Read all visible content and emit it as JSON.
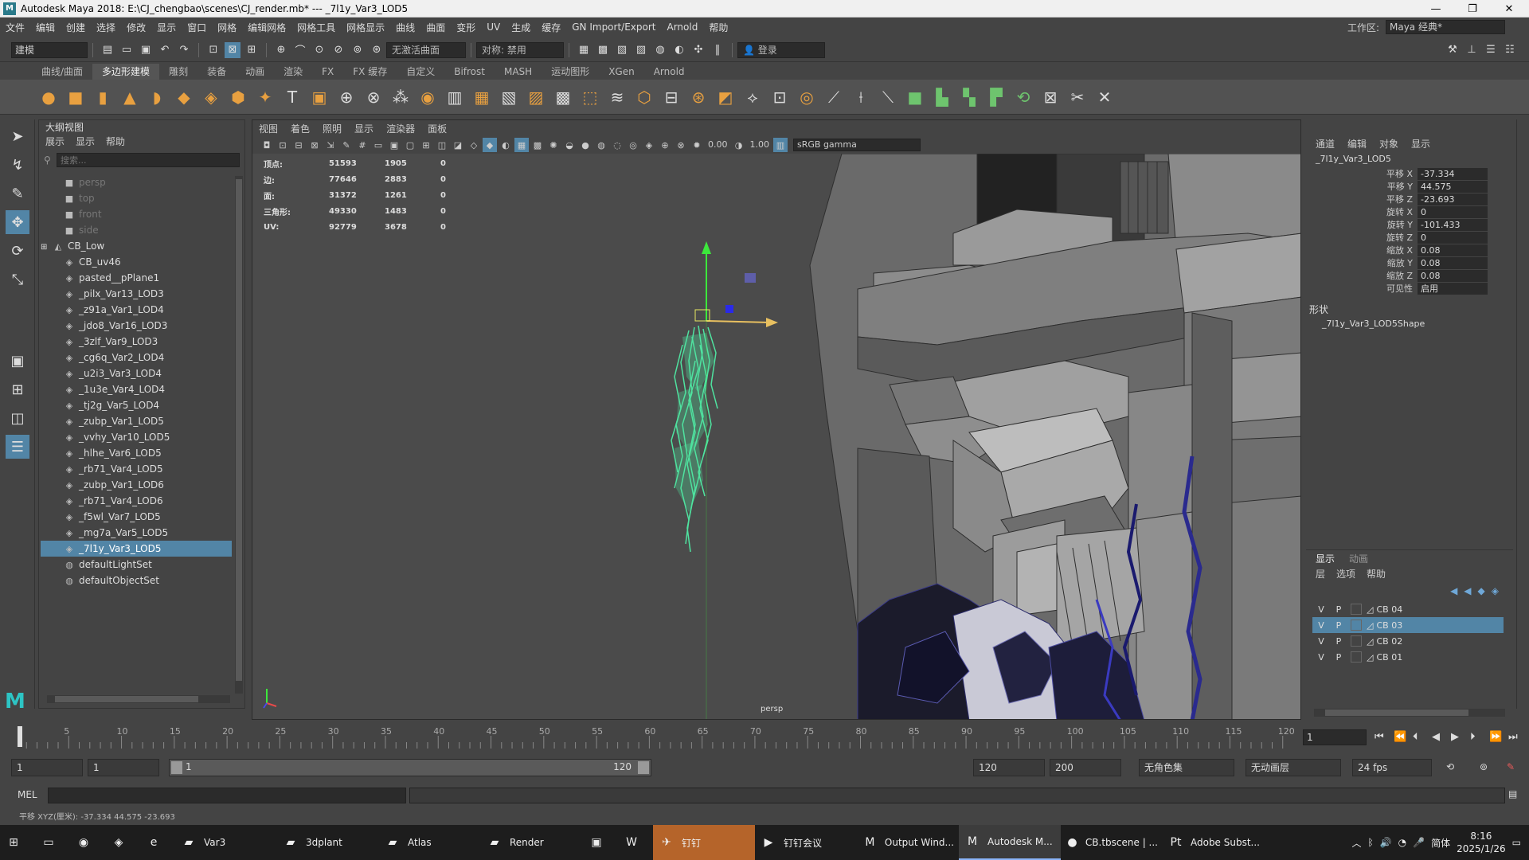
{
  "window": {
    "title": "Autodesk Maya 2018: E:\\CJ_chengbao\\scenes\\CJ_render.mb*   ---   _7l1y_Var3_LOD5",
    "app_icon": "M",
    "min": "—",
    "restore": "❐",
    "close": "✕"
  },
  "menubar": [
    "文件",
    "编辑",
    "创建",
    "选择",
    "修改",
    "显示",
    "窗口",
    "网格",
    "编辑网格",
    "网格工具",
    "网格显示",
    "曲线",
    "曲面",
    "变形",
    "UV",
    "生成",
    "缓存",
    "GN Import/Export",
    "Arnold",
    "帮助"
  ],
  "workspace": {
    "label": "工作区:",
    "value": "Maya 经典*"
  },
  "statusline": {
    "mode": "建模",
    "live_surface": "无激活曲面",
    "symmetry": "对称: 禁用",
    "login": "登录"
  },
  "shelf_tabs": [
    "曲线/曲面",
    "多边形建模",
    "雕刻",
    "装备",
    "动画",
    "渲染",
    "FX",
    "FX 缓存",
    "自定义",
    "Bifrost",
    "MASH",
    "运动图形",
    "XGen",
    "Arnold"
  ],
  "shelf_active": "多边形建模",
  "outliner": {
    "title": "大纲视图",
    "menu": [
      "展示",
      "显示",
      "帮助"
    ],
    "search_placeholder": "搜索...",
    "items": [
      {
        "label": "persp",
        "icon": "camera-icon",
        "dim": true,
        "indent": 2
      },
      {
        "label": "top",
        "icon": "camera-icon",
        "dim": true,
        "indent": 2
      },
      {
        "label": "front",
        "icon": "camera-icon",
        "dim": true,
        "indent": 2
      },
      {
        "label": "side",
        "icon": "camera-icon",
        "dim": true,
        "indent": 2
      },
      {
        "label": "CB_Low",
        "icon": "group-icon",
        "dim": false,
        "indent": 1,
        "expand": "⊞"
      },
      {
        "label": "CB_uv46",
        "icon": "mesh-icon",
        "dim": false,
        "indent": 2
      },
      {
        "label": "pasted__pPlane1",
        "icon": "mesh-icon",
        "dim": false,
        "indent": 2
      },
      {
        "label": "_pilx_Var13_LOD3",
        "icon": "mesh-icon",
        "dim": false,
        "indent": 2
      },
      {
        "label": "_z91a_Var1_LOD4",
        "icon": "mesh-icon",
        "dim": false,
        "indent": 2
      },
      {
        "label": "_jdo8_Var16_LOD3",
        "icon": "mesh-icon",
        "dim": false,
        "indent": 2
      },
      {
        "label": "_3zlf_Var9_LOD3",
        "icon": "mesh-icon",
        "dim": false,
        "indent": 2
      },
      {
        "label": "_cg6q_Var2_LOD4",
        "icon": "mesh-icon",
        "dim": false,
        "indent": 2
      },
      {
        "label": "_u2i3_Var3_LOD4",
        "icon": "mesh-icon",
        "dim": false,
        "indent": 2
      },
      {
        "label": "_1u3e_Var4_LOD4",
        "icon": "mesh-icon",
        "dim": false,
        "indent": 2
      },
      {
        "label": "_tj2g_Var5_LOD4",
        "icon": "mesh-icon",
        "dim": false,
        "indent": 2
      },
      {
        "label": "_zubp_Var1_LOD5",
        "icon": "mesh-icon",
        "dim": false,
        "indent": 2
      },
      {
        "label": "_vvhy_Var10_LOD5",
        "icon": "mesh-icon",
        "dim": false,
        "indent": 2
      },
      {
        "label": "_hlhe_Var6_LOD5",
        "icon": "mesh-icon",
        "dim": false,
        "indent": 2
      },
      {
        "label": "_rb71_Var4_LOD5",
        "icon": "mesh-icon",
        "dim": false,
        "indent": 2
      },
      {
        "label": "_zubp_Var1_LOD6",
        "icon": "mesh-icon",
        "dim": false,
        "indent": 2
      },
      {
        "label": "_rb71_Var4_LOD6",
        "icon": "mesh-icon",
        "dim": false,
        "indent": 2
      },
      {
        "label": "_f5wl_Var7_LOD5",
        "icon": "mesh-icon",
        "dim": false,
        "indent": 2
      },
      {
        "label": "_mg7a_Var5_LOD5",
        "icon": "mesh-icon",
        "dim": false,
        "indent": 2
      },
      {
        "label": "_7l1y_Var3_LOD5",
        "icon": "mesh-icon",
        "dim": false,
        "indent": 2,
        "selected": true
      },
      {
        "label": "defaultLightSet",
        "icon": "set-icon",
        "dim": false,
        "indent": 2
      },
      {
        "label": "defaultObjectSet",
        "icon": "set-icon",
        "dim": false,
        "indent": 2
      }
    ]
  },
  "viewport": {
    "menu": [
      "视图",
      "着色",
      "照明",
      "显示",
      "渲染器",
      "面板"
    ],
    "exposure": "0.00",
    "gamma": "1.00",
    "colorspace": "sRGB gamma",
    "camera": "persp",
    "hud": [
      {
        "label": "顶点:",
        "a": "51593",
        "b": "1905",
        "c": "0"
      },
      {
        "label": "边:",
        "a": "77646",
        "b": "2883",
        "c": "0"
      },
      {
        "label": "面:",
        "a": "31372",
        "b": "1261",
        "c": "0"
      },
      {
        "label": "三角形:",
        "a": "49330",
        "b": "1483",
        "c": "0"
      },
      {
        "label": "UV:",
        "a": "92779",
        "b": "3678",
        "c": "0"
      }
    ]
  },
  "channelbox": {
    "menu": [
      "通道",
      "编辑",
      "对象",
      "显示"
    ],
    "node": "_7l1y_Var3_LOD5",
    "attrs": [
      {
        "name": "平移 X",
        "value": "-37.334"
      },
      {
        "name": "平移 Y",
        "value": "44.575"
      },
      {
        "name": "平移 Z",
        "value": "-23.693"
      },
      {
        "name": "旋转 X",
        "value": "0"
      },
      {
        "name": "旋转 Y",
        "value": "-101.433"
      },
      {
        "name": "旋转 Z",
        "value": "0"
      },
      {
        "name": "缩放 X",
        "value": "0.08"
      },
      {
        "name": "缩放 Y",
        "value": "0.08"
      },
      {
        "name": "缩放 Z",
        "value": "0.08"
      },
      {
        "name": "可见性",
        "value": "启用"
      }
    ],
    "shapes_label": "形状",
    "shape": "_7l1y_Var3_LOD5Shape"
  },
  "layers": {
    "tabs": [
      "显示",
      "动画"
    ],
    "menu": [
      "层",
      "选项",
      "帮助"
    ],
    "rows": [
      {
        "v": "V",
        "p": "P",
        "name": "CB 04"
      },
      {
        "v": "V",
        "p": "P",
        "name": "CB 03",
        "selected": true
      },
      {
        "v": "V",
        "p": "P",
        "name": "CB 02"
      },
      {
        "v": "V",
        "p": "P",
        "name": "CB 01"
      }
    ]
  },
  "timeslider": {
    "ticks": [
      "5",
      "10",
      "15",
      "20",
      "25",
      "30",
      "35",
      "40",
      "45",
      "50",
      "55",
      "60",
      "65",
      "70",
      "75",
      "80",
      "85",
      "90",
      "95",
      "100",
      "105",
      "110",
      "115",
      "120"
    ],
    "current_frame": "1"
  },
  "range": {
    "start": "1",
    "anim_start": "1",
    "range_start": "1",
    "range_end": "120",
    "anim_end": "120",
    "end": "200",
    "char_set": "无角色集",
    "anim_layer": "无动画层",
    "fps": "24 fps"
  },
  "cmdline": {
    "label": "MEL"
  },
  "helpline": "平移 XYZ(厘米):   -37.334        44.575        -23.693",
  "taskbar": {
    "items": [
      {
        "label": "",
        "icon": "⊞",
        "kind": "start"
      },
      {
        "label": "",
        "icon": "▭",
        "kind": "taskview"
      },
      {
        "label": "",
        "icon": "◉",
        "kind": "chrome"
      },
      {
        "label": "",
        "icon": "◈",
        "kind": "app"
      },
      {
        "label": "",
        "icon": "e",
        "kind": "edge"
      },
      {
        "label": "Var3",
        "icon": "▰",
        "kind": "folder"
      },
      {
        "label": "3dplant",
        "icon": "▰",
        "kind": "folder"
      },
      {
        "label": "Atlas",
        "icon": "▰",
        "kind": "folder"
      },
      {
        "label": "Render",
        "icon": "▰",
        "kind": "folder"
      },
      {
        "label": "",
        "icon": "▣",
        "kind": "store"
      },
      {
        "label": "",
        "icon": "W",
        "kind": "wps"
      },
      {
        "label": "钉钉",
        "icon": "✈",
        "kind": "dingtalk",
        "hl": true
      },
      {
        "label": "钉钉会议",
        "icon": "▶",
        "kind": "meeting"
      },
      {
        "label": "Output Wind...",
        "icon": "M",
        "kind": "maya-out"
      },
      {
        "label": "Autodesk M...",
        "icon": "M",
        "kind": "maya",
        "active": true
      },
      {
        "label": "CB.tbscene | ...",
        "icon": "●",
        "kind": "toolbag"
      },
      {
        "label": "Adobe Subst...",
        "icon": "Pt",
        "kind": "painter"
      }
    ],
    "ime": "简体",
    "time": "8:16",
    "date": "2025/1/26"
  },
  "colors": {
    "selection": "#5285a6",
    "panel": "#444444",
    "viewport_bg": "#4b4b4b",
    "hair_green": "#4fe3a0",
    "foliage_blue": "#1a1a6e"
  }
}
